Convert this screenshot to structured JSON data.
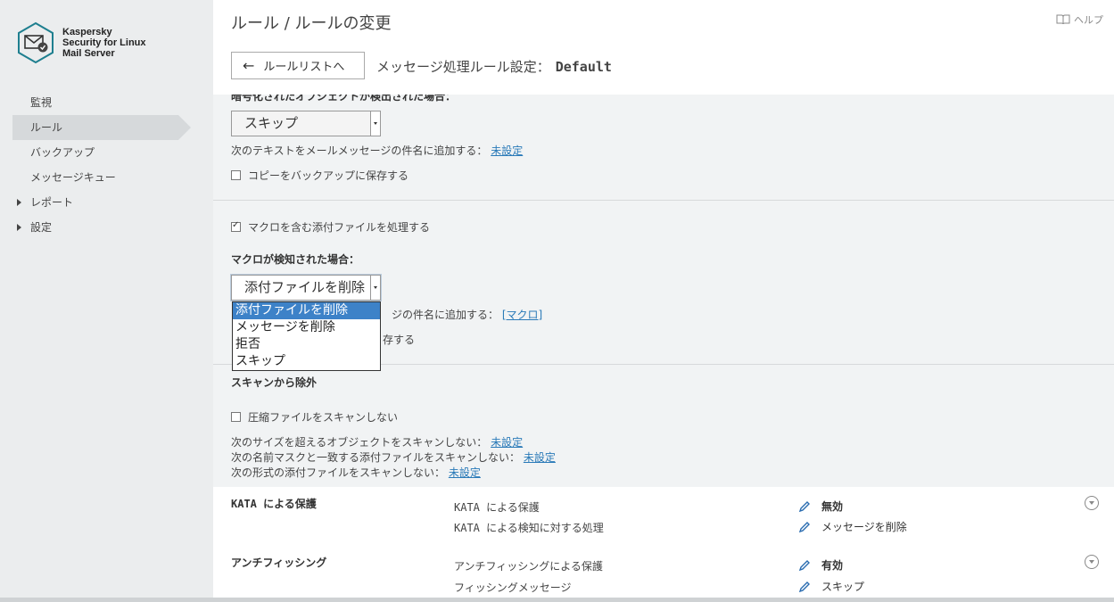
{
  "product": {
    "line1": "Kaspersky",
    "line2": "Security for Linux",
    "line3": "Mail Server"
  },
  "sidebar": {
    "items": [
      {
        "label": "監視"
      },
      {
        "label": "ルール"
      },
      {
        "label": "バックアップ"
      },
      {
        "label": "メッセージキュー"
      },
      {
        "label": "レポート"
      },
      {
        "label": "設定"
      }
    ]
  },
  "header": {
    "breadcrumb": "ルール / ルールの変更",
    "help": "ヘルプ",
    "back_button": "ルールリストへ",
    "rule_title_prefix": "メッセージ処理ルール設定：",
    "rule_name": "Default"
  },
  "encrypted": {
    "heading_partial": "暗号化されたオブジェクトが検出された場合：",
    "select_value": "スキップ",
    "subject_text": "次のテキストをメールメッセージの件名に追加する：",
    "subject_link": "未設定",
    "backup_label": "コピーをバックアップに保存する"
  },
  "macro": {
    "process_label": "マクロを含む添付ファイルを処理する",
    "heading": "マクロが検知された場合：",
    "select_value": "添付ファイルを削除",
    "subject_text_partial": "ジの件名に追加する：",
    "subject_link": "[マクロ]",
    "backup_partial": "存する",
    "options": [
      "添付ファイルを削除",
      "メッセージを削除",
      "拒否",
      "スキップ"
    ]
  },
  "exclusions": {
    "heading": "スキャンから除外",
    "archive_label": "圧縮ファイルをスキャンしない",
    "size_text": "次のサイズを超えるオブジェクトをスキャンしない：",
    "size_link": "未設定",
    "mask_text": "次の名前マスクと一致する添付ファイルをスキャンしない：",
    "mask_link": "未設定",
    "format_text": "次の形式の添付ファイルをスキャンしない：",
    "format_link": "未設定"
  },
  "kata": {
    "title": "KATA による保護",
    "label1": "KATA による保護",
    "value1": "無効",
    "label2": "KATA による検知に対する処理",
    "value2": "メッセージを削除"
  },
  "antiphishing": {
    "title": "アンチフィッシング",
    "label1": "アンチフィッシングによる保護",
    "value1": "有効",
    "label2": "フィッシングメッセージ",
    "value2": "スキップ"
  }
}
